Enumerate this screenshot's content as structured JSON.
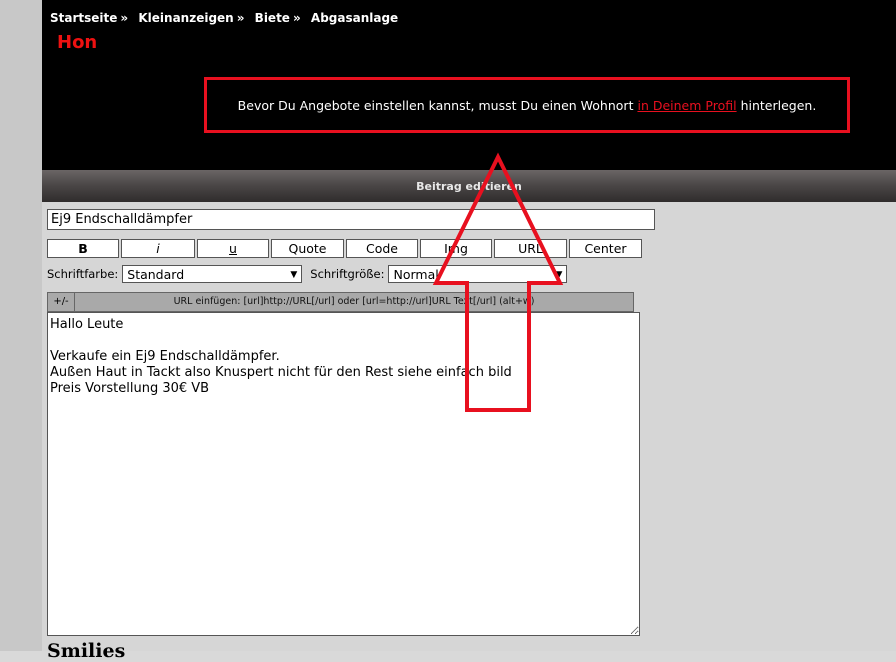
{
  "breadcrumb": [
    "Startseite",
    "Kleinanzeigen",
    "Biete",
    "Abgasanlage"
  ],
  "breadcrumb_separator": "»",
  "title": "Hon",
  "notice": {
    "before": "Bevor Du Angebote einstellen kannst, musst Du einen Wohnort",
    "link": "in Deinem Profil",
    "after": "hinterlegen."
  },
  "section_title": "Beitrag editieren",
  "subject_value": "Ej9 Endschalldämpfer",
  "toolbar": [
    "B",
    "i",
    "u",
    "Quote",
    "Code",
    "Img",
    "URL",
    "Center"
  ],
  "font_color_label": "Schriftfarbe:",
  "font_color_value": "Standard",
  "font_size_label": "Schriftgröße:",
  "font_size_value": "Normal",
  "toggle_label": "+/-",
  "hint_text": "URL einfügen: [url]http://URL[/url] oder [url=http://url]URL Text[/url]  (alt+w)",
  "message": "Hallo Leute\n\nVerkaufe ein Ej9 Endschalldämpfer.\nAußen Haut in Tackt also Knuspert nicht für den Rest siehe einfach bild\nPreis Vorstellung 30€ VB",
  "smilies_heading": "Smilies",
  "colors": {
    "accent_red": "#e8101f",
    "header_bg": "#000000"
  }
}
